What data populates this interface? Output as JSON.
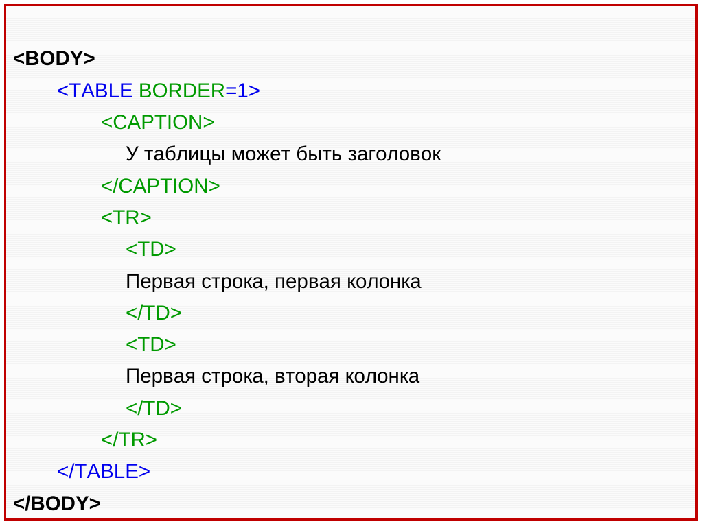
{
  "code": {
    "body_open_lt": "<",
    "body_open_tag": "BODY",
    "body_open_gt": ">",
    "table_open_lt": "<",
    "table_open_tag": "TABLE",
    "table_border_attr": " BORDER",
    "table_eq1_gt": "=1>",
    "caption_open_lt": "<",
    "caption_open_tag": "CAPTION",
    "caption_open_gt": ">",
    "caption_text": "У таблицы может быть заголовок",
    "caption_close_lt": "<",
    "caption_close_tag": "/CAPTION",
    "caption_close_gt": ">",
    "tr_open_lt": "<",
    "tr_open_tag": "TR",
    "tr_open_gt": ">",
    "td1_open_lt": "<",
    "td1_open_tag": "TD",
    "td1_open_gt": ">",
    "td1_text": "Первая строка, первая колонка",
    "td1_close_lt": "<",
    "td1_close_tag": "/TD",
    "td1_close_gt": ">",
    "td2_open_lt": "<",
    "td2_open_tag": "TD",
    "td2_open_gt": ">",
    "td2_text": "Первая строка, вторая колонка",
    "td2_close_lt": "<",
    "td2_close_tag": "/TD",
    "td2_close_gt": ">",
    "tr_close_lt": "<",
    "tr_close_tag": "/TR",
    "tr_close_gt": ">",
    "table_close_lt": "<",
    "table_close_tag": "/TABLE",
    "table_close_gt": ">",
    "body_close_lt": "<",
    "body_close_tag": "/BODY",
    "body_close_gt": ">"
  }
}
